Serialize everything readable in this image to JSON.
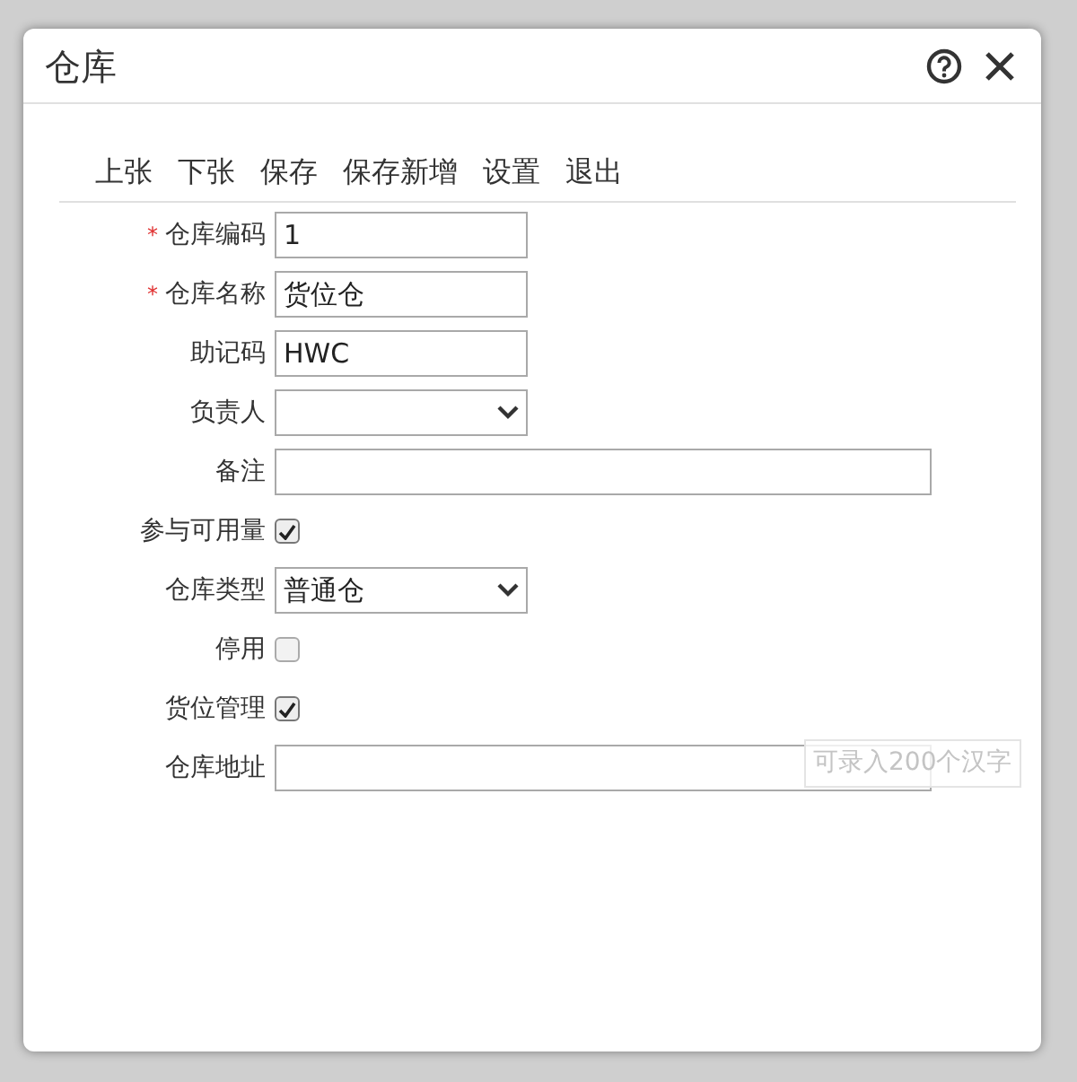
{
  "window": {
    "title": "仓库"
  },
  "toolbar": [
    "上张",
    "下张",
    "保存",
    "保存新增",
    "设置",
    "退出"
  ],
  "fields": [
    {
      "kind": "text",
      "label": "仓库编码",
      "marker": "*",
      "value": "1",
      "wide": false
    },
    {
      "kind": "text",
      "label": "仓库名称",
      "marker": "*",
      "value": "货位仓",
      "wide": false
    },
    {
      "kind": "text",
      "label": "助记码",
      "value": "HWC",
      "wide": false
    },
    {
      "kind": "select",
      "label": "负责人"
    },
    {
      "kind": "text",
      "label": "备注",
      "wide": true
    },
    {
      "kind": "checkbox",
      "label": "参与可用量",
      "checked": true
    },
    {
      "kind": "select",
      "label": "仓库类型",
      "value": "普通仓"
    },
    {
      "kind": "checkbox",
      "label": "停用",
      "checked": false
    },
    {
      "kind": "checkbox",
      "label": "货位管理",
      "checked": true
    },
    {
      "kind": "text",
      "label": "仓库地址",
      "wide": true,
      "tooltip": "可录入200个汉字"
    }
  ]
}
